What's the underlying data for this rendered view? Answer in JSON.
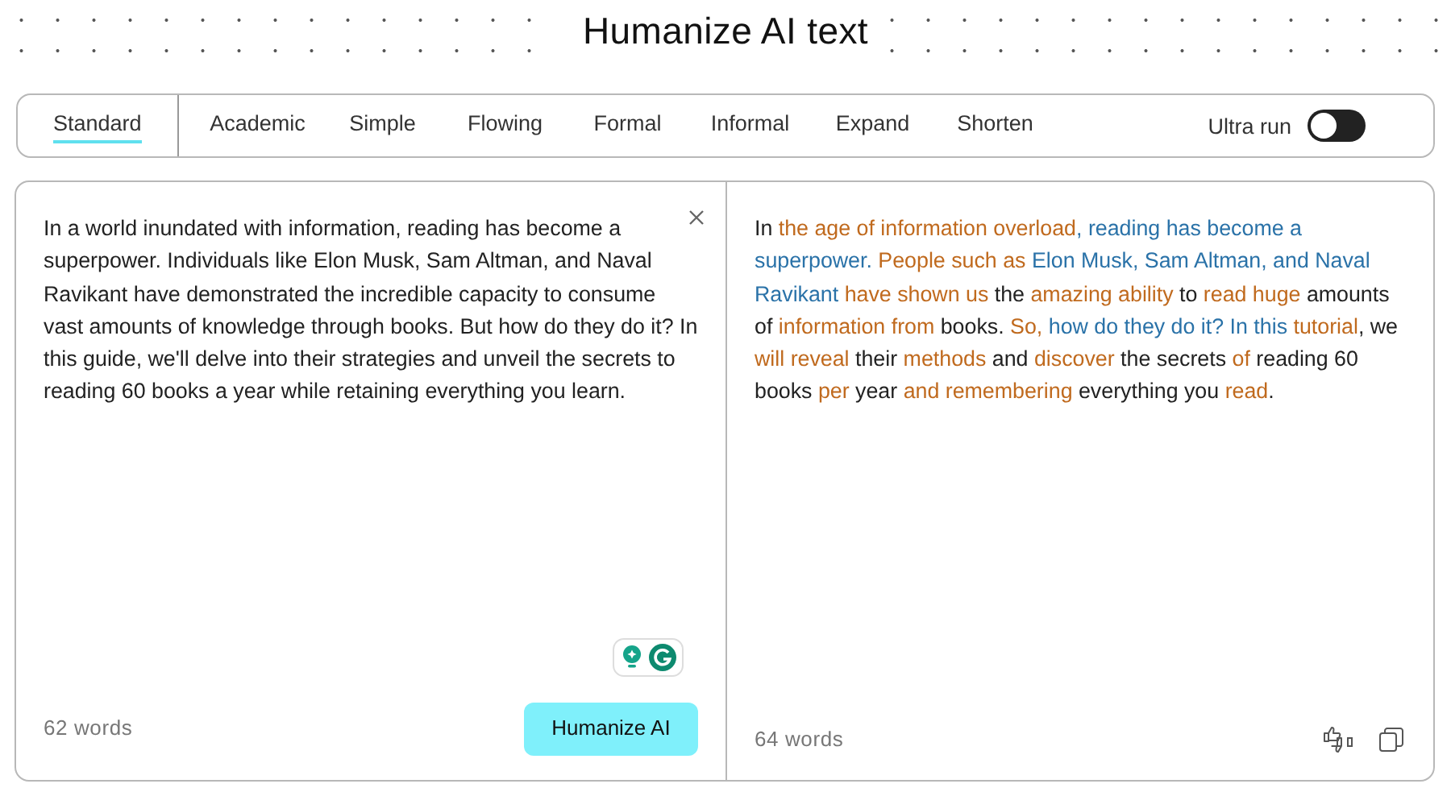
{
  "title": "Humanize AI text",
  "tabs": [
    {
      "label": "Standard",
      "selected": true
    },
    {
      "label": "Academic",
      "selected": false
    },
    {
      "label": "Simple",
      "selected": false
    },
    {
      "label": "Flowing",
      "selected": false
    },
    {
      "label": "Formal",
      "selected": false
    },
    {
      "label": "Informal",
      "selected": false
    },
    {
      "label": "Expand",
      "selected": false
    },
    {
      "label": "Shorten",
      "selected": false
    }
  ],
  "ultra_run": {
    "label": "Ultra run",
    "on": false
  },
  "input": {
    "text": "In a world inundated with information, reading has become a superpower. Individuals like Elon Musk, Sam Altman, and Naval Ravikant have demonstrated the incredible capacity to consume vast amounts of knowledge through books. But how do they do it? In this guide, we'll delve into their strategies and unveil the secrets to reading 60 books a year while retaining everything you learn.",
    "word_count": "62 words",
    "button": "Humanize AI"
  },
  "output": {
    "segments": [
      {
        "text": "In ",
        "kind": "plain"
      },
      {
        "text": "the age of information overload",
        "kind": "changed"
      },
      {
        "text": ", reading has become a superpower. ",
        "kind": "rephrased"
      },
      {
        "text": "People such as",
        "kind": "changed"
      },
      {
        "text": " Elon Musk, Sam Altman, and Naval Ravikant ",
        "kind": "rephrased"
      },
      {
        "text": "have shown us",
        "kind": "changed"
      },
      {
        "text": " the ",
        "kind": "plain"
      },
      {
        "text": "amazing ability",
        "kind": "changed"
      },
      {
        "text": " to ",
        "kind": "plain"
      },
      {
        "text": "read huge",
        "kind": "changed"
      },
      {
        "text": " amounts of ",
        "kind": "plain"
      },
      {
        "text": "information from",
        "kind": "changed"
      },
      {
        "text": " books. ",
        "kind": "plain"
      },
      {
        "text": "So,",
        "kind": "changed"
      },
      {
        "text": " how do they do it? In this ",
        "kind": "rephrased"
      },
      {
        "text": "tutorial",
        "kind": "changed"
      },
      {
        "text": ", we ",
        "kind": "plain"
      },
      {
        "text": "will reveal",
        "kind": "changed"
      },
      {
        "text": " their ",
        "kind": "plain"
      },
      {
        "text": "methods",
        "kind": "changed"
      },
      {
        "text": " and ",
        "kind": "plain"
      },
      {
        "text": "discover",
        "kind": "changed"
      },
      {
        "text": " the secrets ",
        "kind": "plain"
      },
      {
        "text": "of",
        "kind": "changed"
      },
      {
        "text": " reading 60 books ",
        "kind": "plain"
      },
      {
        "text": "per",
        "kind": "changed"
      },
      {
        "text": " year ",
        "kind": "plain"
      },
      {
        "text": "and remembering",
        "kind": "changed"
      },
      {
        "text": " everything you ",
        "kind": "plain"
      },
      {
        "text": "read",
        "kind": "changed"
      },
      {
        "text": ".",
        "kind": "plain"
      }
    ],
    "word_count": "64 words"
  }
}
